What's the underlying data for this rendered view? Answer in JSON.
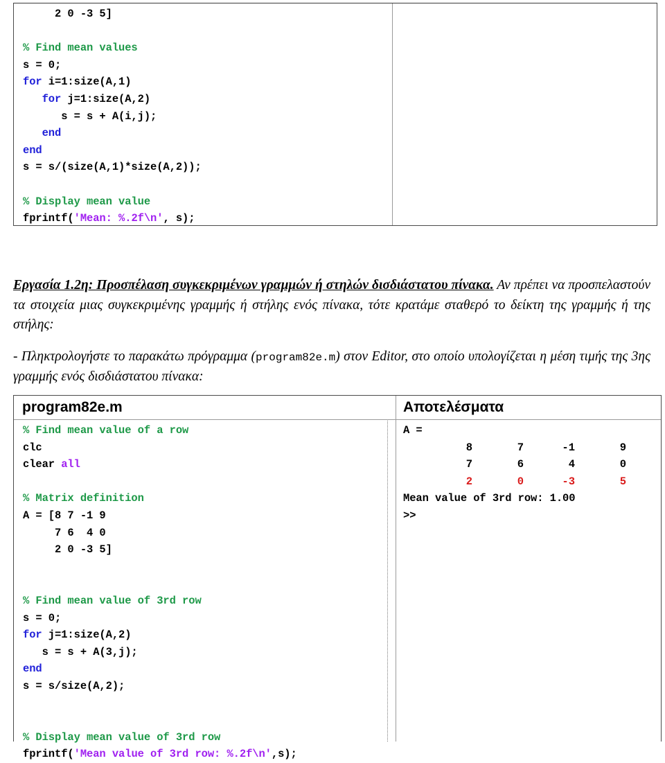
{
  "top_listing": {
    "lines": [
      {
        "indent": 5,
        "segments": [
          {
            "t": "2 0 -3 5]",
            "c": "plain"
          }
        ]
      },
      {
        "indent": 0,
        "segments": []
      },
      {
        "indent": 0,
        "segments": [
          {
            "t": "% Find mean values",
            "c": "cmt"
          }
        ]
      },
      {
        "indent": 0,
        "segments": [
          {
            "t": "s = 0;",
            "c": "plain"
          }
        ]
      },
      {
        "indent": 0,
        "segments": [
          {
            "t": "for",
            "c": "kw"
          },
          {
            "t": " i=1:size(A,1)",
            "c": "plain"
          }
        ]
      },
      {
        "indent": 3,
        "segments": [
          {
            "t": "for",
            "c": "kw"
          },
          {
            "t": " j=1:size(A,2)",
            "c": "plain"
          }
        ]
      },
      {
        "indent": 6,
        "segments": [
          {
            "t": "s = s + A(i,j);",
            "c": "plain"
          }
        ]
      },
      {
        "indent": 3,
        "segments": [
          {
            "t": "end",
            "c": "kw"
          }
        ]
      },
      {
        "indent": 0,
        "segments": [
          {
            "t": "end",
            "c": "kw"
          }
        ]
      },
      {
        "indent": 0,
        "segments": [
          {
            "t": "s = s/(size(A,1)*size(A,2));",
            "c": "plain"
          }
        ]
      },
      {
        "indent": 0,
        "segments": []
      },
      {
        "indent": 0,
        "segments": [
          {
            "t": "% Display mean value",
            "c": "cmt"
          }
        ]
      },
      {
        "indent": 0,
        "segments": [
          {
            "t": "fprintf(",
            "c": "plain"
          },
          {
            "t": "'Mean: %.2f\\n'",
            "c": "str"
          },
          {
            "t": ", s);",
            "c": "plain"
          }
        ]
      }
    ]
  },
  "prose": {
    "heading": "Εργασία 1.2η: Προσπέλαση συγκεκριμένων γραμμών ή στηλών δισδιάστατου πίνακα.",
    "para1_rest": " Αν πρέπει να προσπελαστούν τα στοιχεία μιας συγκεκριμένης γραμμής ή στήλης ενός πίνακα, τότε κρατάμε σταθερό το δείκτη της γραμμής ή της στήλης:",
    "para2_a": "- Πληκτρολογήστε το παρακάτω πρόγραμμα (",
    "para2_mono": "program82e.m",
    "para2_b": ") στον Editor, στο οποίο υπολογίζεται η μέση τιμής της 3ης γραμμής ενός δισδιάστατου πίνακα:"
  },
  "table": {
    "header_left": "program82e.m",
    "header_right": "Αποτελέσματα"
  },
  "bottom_listing": {
    "lines": [
      {
        "indent": 0,
        "segments": [
          {
            "t": "% Find mean value of a row",
            "c": "cmt"
          }
        ]
      },
      {
        "indent": 0,
        "segments": [
          {
            "t": "clc",
            "c": "plain"
          }
        ]
      },
      {
        "indent": 0,
        "segments": [
          {
            "t": "clear ",
            "c": "plain"
          },
          {
            "t": "all",
            "c": "str"
          }
        ]
      },
      {
        "indent": 0,
        "segments": []
      },
      {
        "indent": 0,
        "segments": [
          {
            "t": "% Matrix definition",
            "c": "cmt"
          }
        ]
      },
      {
        "indent": 0,
        "segments": [
          {
            "t": "A = [8 7 -1 9",
            "c": "plain"
          }
        ]
      },
      {
        "indent": 5,
        "segments": [
          {
            "t": "7 6  4 0",
            "c": "plain"
          }
        ]
      },
      {
        "indent": 5,
        "segments": [
          {
            "t": "2 0 -3 5]",
            "c": "plain"
          }
        ]
      },
      {
        "indent": 0,
        "segments": []
      },
      {
        "indent": 0,
        "segments": []
      },
      {
        "indent": 0,
        "segments": [
          {
            "t": "% Find mean value of 3rd row",
            "c": "cmt"
          }
        ]
      },
      {
        "indent": 0,
        "segments": [
          {
            "t": "s = 0;",
            "c": "plain"
          }
        ]
      },
      {
        "indent": 0,
        "segments": [
          {
            "t": "for",
            "c": "kw"
          },
          {
            "t": " j=1:size(A,2)",
            "c": "plain"
          }
        ]
      },
      {
        "indent": 3,
        "segments": [
          {
            "t": "s = s + A(3,j);",
            "c": "plain"
          }
        ]
      },
      {
        "indent": 0,
        "segments": [
          {
            "t": "end",
            "c": "kw"
          }
        ]
      },
      {
        "indent": 0,
        "segments": [
          {
            "t": "s = s/size(A,2);",
            "c": "plain"
          }
        ]
      },
      {
        "indent": 0,
        "segments": []
      },
      {
        "indent": 0,
        "segments": []
      },
      {
        "indent": 0,
        "segments": [
          {
            "t": "% Display mean value of 3rd row",
            "c": "cmt"
          }
        ]
      },
      {
        "indent": 0,
        "segments": [
          {
            "t": "fprintf(",
            "c": "plain"
          },
          {
            "t": "'Mean value of 3rd row: %.2f\\n'",
            "c": "str"
          },
          {
            "t": ",s);",
            "c": "plain"
          }
        ]
      }
    ]
  },
  "results": {
    "var_line": "A =",
    "matrix": {
      "rows": [
        {
          "values": [
            "8",
            "7",
            "-1",
            "9"
          ],
          "color": "plain"
        },
        {
          "values": [
            "7",
            "6",
            "4",
            "0"
          ],
          "color": "plain"
        },
        {
          "values": [
            "2",
            "0",
            "-3",
            "5"
          ],
          "color": "red"
        }
      ]
    },
    "mean_line": "Mean value of 3rd row: 1.00",
    "prompt": ">>"
  },
  "colors": {
    "comment": "#1E9948",
    "keyword": "#2121D9",
    "string": "#A020F0",
    "highlight": "#D91A1A",
    "border": "#4a4a4a"
  }
}
